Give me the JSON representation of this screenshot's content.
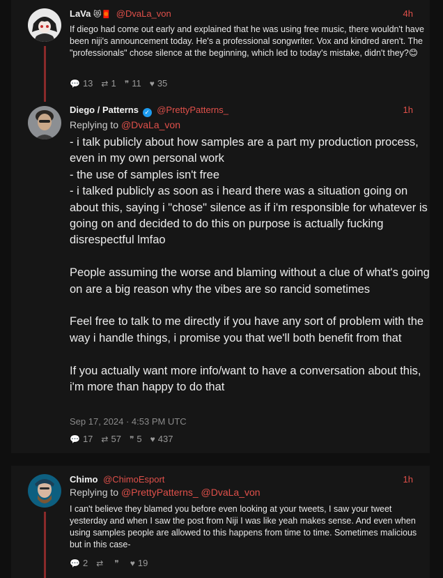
{
  "posts": [
    {
      "name": "LaVa",
      "name_emojis": "😻🧧",
      "handle": "@DvaLa_von",
      "time": "4h",
      "text": "If diego had come out early and explained that he was using free music, there wouldn't have been niji's announcement today. He's a professional songwriter. Vox and kindred aren't. The \"professionals\" chose silence at the beginning, which led to today's mistake, didn't they?😊",
      "stats": {
        "replies": "13",
        "reposts": "1",
        "quotes": "11",
        "likes": "35"
      }
    },
    {
      "name": "Diego / Patterns",
      "handle": "@PrettyPatterns_",
      "time": "1h",
      "reply_label": "Replying to",
      "reply_handle": "@DvaLa_von",
      "paragraphs": [
        [
          "- i talk publicly about how samples are a part my production process, even in my own personal work",
          "- the use of samples isn't free",
          "- i talked publicly as soon as i heard there was a situation going on about this, saying i \"chose\" silence as if i'm responsible for whatever is going on and decided to do this on purpose is actually fucking disrespectful lmfao"
        ],
        [
          "People assuming the worse and blaming without a clue of what's going on are a big reason why the vibes are so rancid sometimes"
        ],
        [
          "Feel free to talk to me directly if you have any sort of problem with the way i handle things, i promise you that we'll both benefit from that"
        ],
        [
          "If you actually want more info/want to have a conversation about this, i'm more than happy to do that"
        ]
      ],
      "date": "Sep 17, 2024 · 4:53 PM UTC",
      "stats": {
        "replies": "17",
        "reposts": "57",
        "quotes": "5",
        "likes": "437"
      }
    },
    {
      "name": "Chimo",
      "handle": "@ChimoEsport",
      "time": "1h",
      "reply_label": "Replying to",
      "reply_handle_1": "@PrettyPatterns_",
      "reply_handle_2": "@DvaLa_von",
      "text": "I can't believe they blamed you  before even looking at your tweets, I saw your tweet yesterday and when I saw the post from Niji I was like yeah makes sense. And even when using samples people are allowed to this happens from time to time. Sometimes malicious but in this case-",
      "stats": {
        "replies": "2",
        "reposts": "",
        "quotes": "",
        "likes": "19"
      }
    }
  ],
  "colors": {
    "accent": "#e0504a",
    "thread_line": "#8a2a2a",
    "card": "#161616",
    "page": "#0f0f0f"
  }
}
